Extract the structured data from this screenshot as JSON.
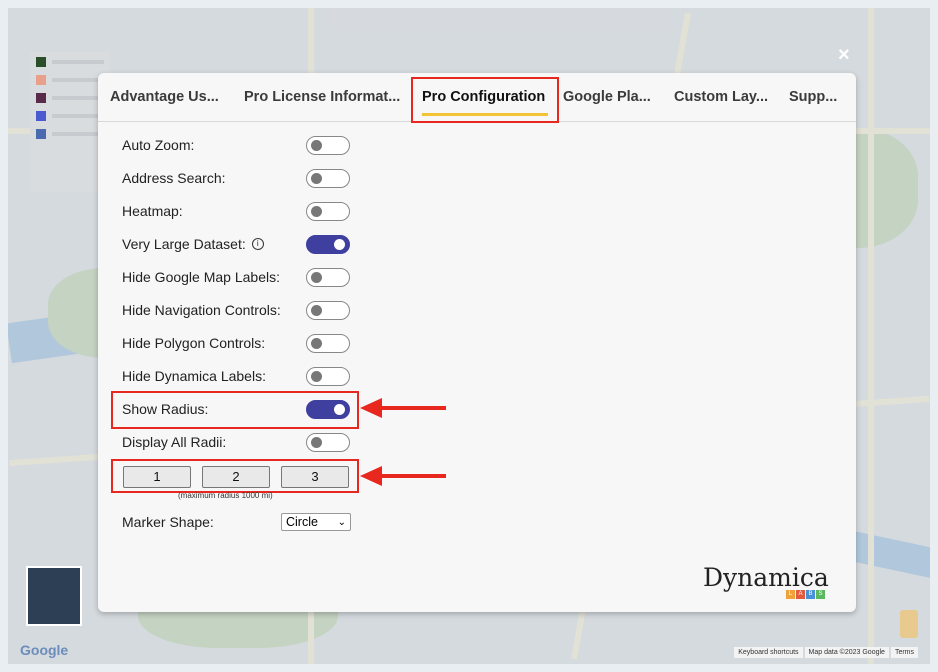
{
  "tabs": [
    {
      "label": "Advantage Us..."
    },
    {
      "label": "Pro License Informat..."
    },
    {
      "label": "Pro Configuration"
    },
    {
      "label": "Google Pla..."
    },
    {
      "label": "Custom Lay..."
    },
    {
      "label": "Supp..."
    }
  ],
  "active_tab": "Pro Configuration",
  "settings": [
    {
      "label": "Auto Zoom:",
      "on": false
    },
    {
      "label": "Address Search:",
      "on": false
    },
    {
      "label": "Heatmap:",
      "on": false
    },
    {
      "label": "Very Large Dataset:",
      "on": true,
      "info": "ⓘ"
    },
    {
      "label": "Hide Google Map Labels:",
      "on": false
    },
    {
      "label": "Hide Navigation Controls:",
      "on": false
    },
    {
      "label": "Hide Polygon Controls:",
      "on": false
    },
    {
      "label": "Hide Dynamica Labels:",
      "on": false
    },
    {
      "label": "Show Radius:",
      "on": true
    },
    {
      "label": "Display All Radii:",
      "on": false
    }
  ],
  "radius_inputs": [
    "1",
    "2",
    "3"
  ],
  "radius_note": "(maximum radius 1000 mi)",
  "marker_shape": {
    "label": "Marker Shape:",
    "value": "Circle"
  },
  "logo": {
    "text": "Dynamica",
    "sub": [
      "L",
      "A",
      "B",
      "S"
    ],
    "sub_colors": [
      "#f0a23a",
      "#e25b3f",
      "#4a90d9",
      "#5cb85c"
    ]
  },
  "close_symbol": "×",
  "map": {
    "google_logo": "Google",
    "attribution": [
      "Keyboard shortcuts",
      "Map data ©2023 Google",
      "Terms"
    ]
  },
  "colors": {
    "toggle_on": "#3f3fa0",
    "highlight": "#e8271f",
    "tab_underline": "#f2c335"
  }
}
